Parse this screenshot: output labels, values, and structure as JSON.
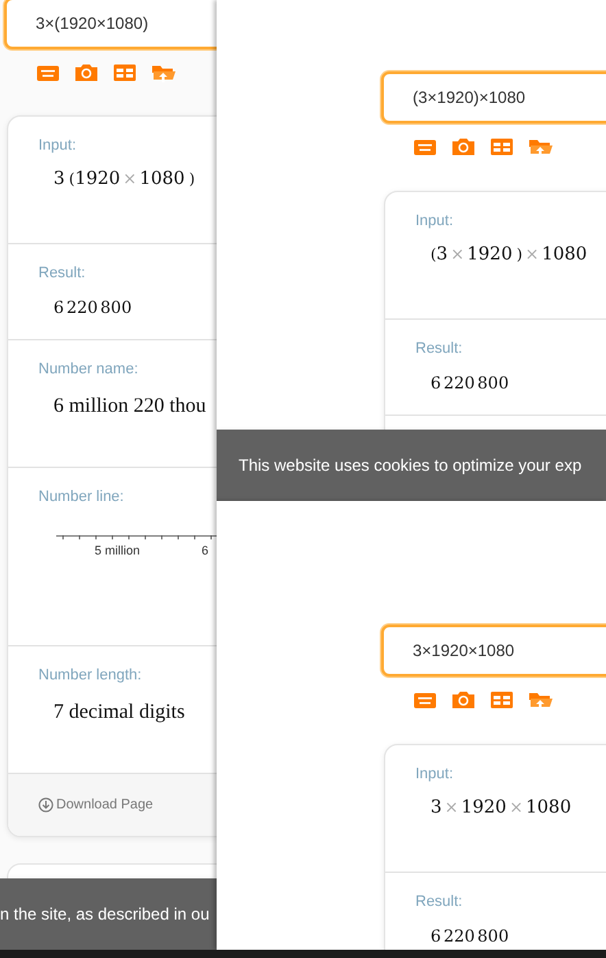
{
  "windows": [
    {
      "search": {
        "value": "3×(1920×1080)"
      },
      "pods": [
        {
          "kind": "math",
          "title": "Input:",
          "tokens": [
            {
              "kind": "num",
              "text": "3"
            },
            {
              "kind": "paren",
              "text": "("
            },
            {
              "kind": "num",
              "text": "1920"
            },
            {
              "kind": "op",
              "text": "×"
            },
            {
              "kind": "num",
              "text": "1080"
            },
            {
              "kind": "paren",
              "text": ")"
            }
          ]
        },
        {
          "kind": "number",
          "title": "Result:",
          "value": "6 220 800"
        },
        {
          "kind": "words",
          "title": "Number name:",
          "value": "6 million 220 thou"
        },
        {
          "kind": "numberline",
          "title": "Number line:",
          "tick_labels": [
            "5 million",
            "6"
          ]
        },
        {
          "kind": "words",
          "title": "Number length:",
          "value": "7 decimal digits"
        }
      ],
      "download_link": "Download Page",
      "next_card": true,
      "cookie_banner": "n the site, as described in ou"
    },
    {
      "search": {
        "value": "(3×1920)×1080"
      },
      "pods": [
        {
          "kind": "math",
          "title": "Input:",
          "tokens": [
            {
              "kind": "paren",
              "text": "("
            },
            {
              "kind": "num",
              "text": "3"
            },
            {
              "kind": "op",
              "text": "×"
            },
            {
              "kind": "num",
              "text": "1920"
            },
            {
              "kind": "paren",
              "text": ")"
            },
            {
              "kind": "op",
              "text": "×"
            },
            {
              "kind": "num",
              "text": "1080"
            }
          ]
        },
        {
          "kind": "number",
          "title": "Result:",
          "value": "6 220 800"
        },
        {
          "kind": "blank"
        }
      ],
      "next_card": false,
      "cookie_banner": "This website uses cookies to optimize your exp"
    },
    {
      "search": {
        "value": "3×1920×1080"
      },
      "pods": [
        {
          "kind": "math",
          "title": "Input:",
          "tokens": [
            {
              "kind": "num",
              "text": "3"
            },
            {
              "kind": "op",
              "text": "×"
            },
            {
              "kind": "num",
              "text": "1920"
            },
            {
              "kind": "op",
              "text": "×"
            },
            {
              "kind": "num",
              "text": "1080"
            }
          ]
        },
        {
          "kind": "number",
          "title": "Result:",
          "value": "6 220 800"
        }
      ],
      "next_card": false
    }
  ]
}
